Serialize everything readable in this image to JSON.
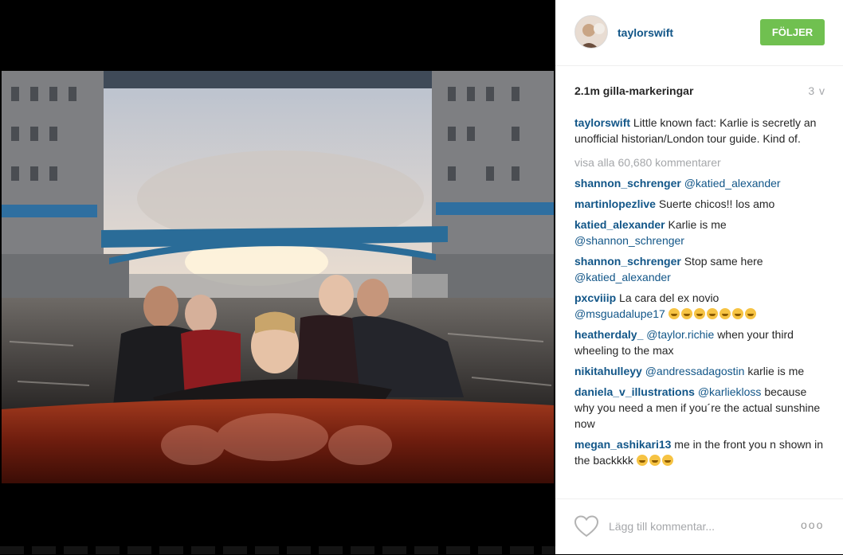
{
  "post": {
    "username": "taylorswift",
    "follow_label": "FÖLJER",
    "likes": "2.1m gilla-markeringar",
    "age": "3 v",
    "caption": "Little known fact: Karlie is secretly an unofficial historian/London tour guide. Kind of.",
    "view_all": "visa alla 60,680 kommentarer"
  },
  "comments": [
    {
      "user": "shannon_schrenger",
      "mention": "@katied_alexander",
      "text": ""
    },
    {
      "user": "martinlopezlive",
      "mention": "",
      "text": "Suerte chicos!! los amo"
    },
    {
      "user": "katied_alexander",
      "mention": "",
      "text": "Karlie is me",
      "mention2": "@shannon_schrenger"
    },
    {
      "user": "shannon_schrenger",
      "mention": "",
      "text": "Stop same here",
      "mention2": "@katied_alexander"
    },
    {
      "user": "pxcviiip",
      "mention": "",
      "text": "La cara del ex novio",
      "mention2": "@msguadalupe17"
    },
    {
      "user": "heatherdaly_",
      "mention": "@taylor.richie",
      "text": "when your third wheeling to the max"
    },
    {
      "user": "nikitahulleyy",
      "mention": "@andressadagostin",
      "text": "karlie is me"
    },
    {
      "user": "daniela_v_illustrations",
      "mention": "@karliekloss",
      "text": "because why you need a men if you´re the actual sunshine now"
    },
    {
      "user": "megan_ashikari13",
      "mention": "",
      "text": "me in the front you n shown in the backkkk"
    }
  ],
  "footer": {
    "add_comment_placeholder": "Lägg till kommentar...",
    "more_label": "ooo"
  },
  "icons": {
    "heart": "heart-icon",
    "more": "more-options-icon"
  },
  "colors": {
    "username": "#125688",
    "follow_button": "#70c050",
    "muted": "#a5a7aa"
  }
}
